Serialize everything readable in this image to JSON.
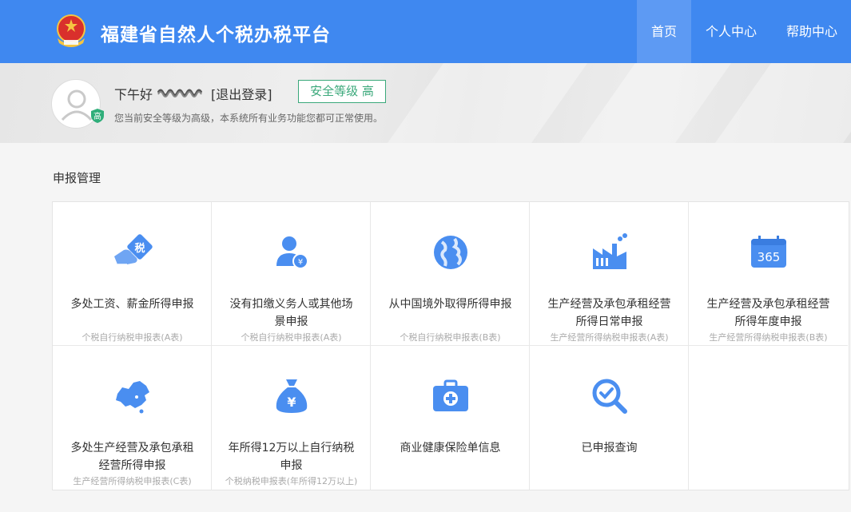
{
  "header": {
    "site_title": "福建省自然人个税办税平台",
    "nav": [
      {
        "label": "首页",
        "active": true
      },
      {
        "label": "个人中心",
        "active": false
      },
      {
        "label": "帮助中心",
        "active": false
      }
    ],
    "colors": {
      "primary": "#3f88f0",
      "nav_active": "#5d9af3"
    }
  },
  "user": {
    "greeting": "下午好",
    "logout_label": "[退出登录]",
    "security_badge": "高",
    "security_level_label": "安全等级 高",
    "security_desc": "您当前安全等级为高级，本系统所有业务功能您都可正常使用。"
  },
  "section": {
    "title": "申报管理"
  },
  "tiles": [
    {
      "icon": "tax-ticket-hand-icon",
      "title": "多处工资、薪金所得申报",
      "subtitle": "个税自行纳税申报表(A表)"
    },
    {
      "icon": "user-yuan-icon",
      "title": "没有扣缴义务人或其他场景申报",
      "subtitle": "个税自行纳税申报表(A表)"
    },
    {
      "icon": "globe-icon",
      "title": "从中国境外取得所得申报",
      "subtitle": "个税自行纳税申报表(B表)"
    },
    {
      "icon": "factory-icon",
      "title": "生产经营及承包承租经营所得日常申报",
      "subtitle": "生产经营所得纳税申报表(A表)"
    },
    {
      "icon": "calendar-365-icon",
      "title": "生产经营及承包承租经营所得年度申报",
      "subtitle": "生产经营所得纳税申报表(B表)",
      "calendar_text": "365"
    },
    {
      "icon": "china-map-icon",
      "title": "多处生产经营及承包承租经营所得申报",
      "subtitle": "生产经营所得纳税申报表(C表)"
    },
    {
      "icon": "money-bag-icon",
      "title": "年所得12万以上自行纳税申报",
      "subtitle": "个税纳税申报表(年所得12万以上)"
    },
    {
      "icon": "medical-kit-icon",
      "title": "商业健康保险单信息",
      "subtitle": ""
    },
    {
      "icon": "search-check-icon",
      "title": "已申报查询",
      "subtitle": ""
    }
  ]
}
